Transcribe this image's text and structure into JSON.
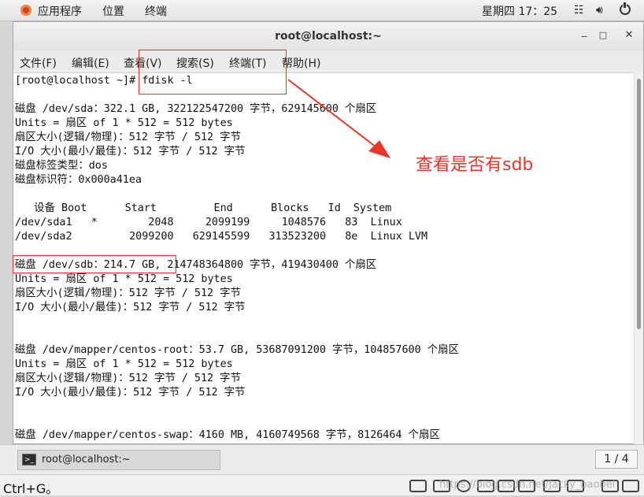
{
  "top_panel": {
    "applications": "应用程序",
    "places": "位置",
    "terminal": "终端",
    "clock": "星期四 17：25"
  },
  "window": {
    "title": "root@localhost:~",
    "controls": {
      "minimize": "_",
      "maximize": "□",
      "close": "✕"
    }
  },
  "menubar": {
    "items": [
      "文件(F)",
      "编辑(E)",
      "查看(V)",
      "搜索(S)",
      "终端(T)",
      "帮助(H)"
    ]
  },
  "terminal": {
    "lines": [
      "[root@localhost ~]# fdisk -l",
      "",
      "磁盘 /dev/sda：322.1 GB, 322122547200 字节，629145600 个扇区",
      "Units = 扇区 of 1 * 512 = 512 bytes",
      "扇区大小(逻辑/物理)：512 字节 / 512 字节",
      "I/O 大小(最小/最佳)：512 字节 / 512 字节",
      "磁盘标签类型：dos",
      "磁盘标识符：0x000a41ea",
      "",
      "   设备 Boot      Start         End      Blocks   Id  System",
      "/dev/sda1   *        2048     2099199     1048576   83  Linux",
      "/dev/sda2         2099200   629145599   313523200   8e  Linux LVM",
      "",
      "磁盘 /dev/sdb：214.7 GB, 214748364800 字节，419430400 个扇区",
      "Units = 扇区 of 1 * 512 = 512 bytes",
      "扇区大小(逻辑/物理)：512 字节 / 512 字节",
      "I/O 大小(最小/最佳)：512 字节 / 512 字节",
      "",
      "",
      "磁盘 /dev/mapper/centos-root：53.7 GB, 53687091200 字节，104857600 个扇区",
      "Units = 扇区 of 1 * 512 = 512 bytes",
      "扇区大小(逻辑/物理)：512 字节 / 512 字节",
      "I/O 大小(最小/最佳)：512 字节 / 512 字节",
      "",
      "",
      "磁盘 /dev/mapper/centos-swap：4160 MB, 4160749568 字节，8126464 个扇区"
    ]
  },
  "annotation": {
    "text": "查看是否有sdb",
    "color": "#e8362a"
  },
  "taskbar": {
    "window_label": "root@localhost:~",
    "page_indicator": "1 / 4"
  },
  "statusbar": {
    "text": "Ctrl+G。",
    "watermark": "https://blog.csdn.net/Jacky_baobei"
  }
}
